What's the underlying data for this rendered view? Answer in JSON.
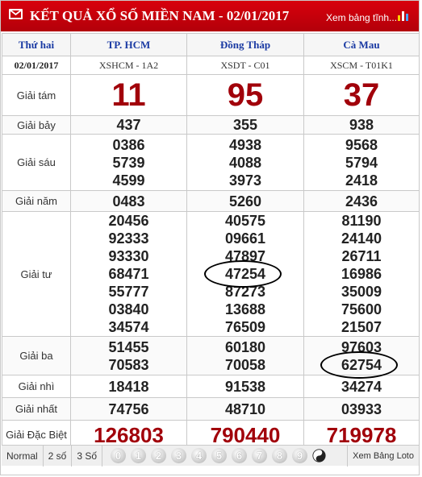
{
  "header": {
    "title": "KẾT QUẢ XỔ SỐ MIỀN NAM - 02/01/2017",
    "link": "Xem bảng tĩnh...",
    "accent": "#c4000b"
  },
  "table": {
    "day": "Thứ hai",
    "date": "02/01/2017",
    "provinces": [
      "TP. HCM",
      "Đồng Tháp",
      "Cà Mau"
    ],
    "codes": [
      "XSHCM - 1A2",
      "XSDT - C01",
      "XSCM - T01K1"
    ],
    "prizes": [
      {
        "label": "Giải tám",
        "values": [
          [
            "11"
          ],
          [
            "95"
          ],
          [
            "37"
          ]
        ]
      },
      {
        "label": "Giải bảy",
        "values": [
          [
            "437"
          ],
          [
            "355"
          ],
          [
            "938"
          ]
        ]
      },
      {
        "label": "Giải sáu",
        "values": [
          [
            "0386",
            "5739",
            "4599"
          ],
          [
            "4938",
            "4088",
            "3973"
          ],
          [
            "9568",
            "5794",
            "2418"
          ]
        ]
      },
      {
        "label": "Giải năm",
        "values": [
          [
            "0483"
          ],
          [
            "5260"
          ],
          [
            "2436"
          ]
        ]
      },
      {
        "label": "Giải tư",
        "values": [
          [
            "20456",
            "92333",
            "93330",
            "68471",
            "55777",
            "03840",
            "34574"
          ],
          [
            "40575",
            "09661",
            "47897",
            "47254",
            "87273",
            "13688",
            "76509"
          ],
          [
            "81190",
            "24140",
            "26711",
            "16986",
            "35009",
            "75600",
            "21507"
          ]
        ]
      },
      {
        "label": "Giải ba",
        "values": [
          [
            "51455",
            "70583"
          ],
          [
            "60180",
            "70058"
          ],
          [
            "97603",
            "62754"
          ]
        ]
      },
      {
        "label": "Giải nhì",
        "values": [
          [
            "18418"
          ],
          [
            "91538"
          ],
          [
            "34274"
          ]
        ]
      },
      {
        "label": "Giải nhất",
        "values": [
          [
            "74756"
          ],
          [
            "48710"
          ],
          [
            "03933"
          ]
        ]
      },
      {
        "label": "Giải Đặc Biệt",
        "values": [
          [
            "126803"
          ],
          [
            "790440"
          ],
          [
            "719978"
          ]
        ]
      }
    ]
  },
  "footer": {
    "modes": [
      "Normal",
      "2 số",
      "3 Số"
    ],
    "digits": [
      "0",
      "1",
      "2",
      "3",
      "4",
      "5",
      "6",
      "7",
      "8",
      "9"
    ],
    "link": "Xem Bảng Loto"
  }
}
